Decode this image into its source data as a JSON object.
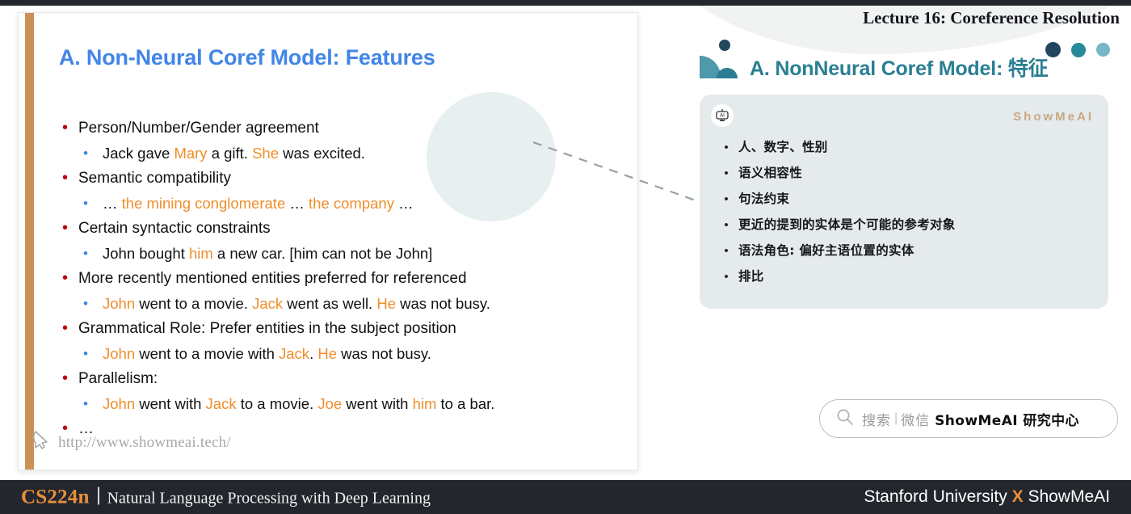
{
  "header": {
    "lecture_title": "Lecture 16: Coreference Resolution"
  },
  "slide": {
    "title": "A. Non-Neural Coref Model: Features",
    "watermark_url": "http://www.showmeai.tech/",
    "bullets": [
      {
        "level": 1,
        "bullet_char": "•",
        "segments": [
          {
            "text": "Person/Number/Gender agreement",
            "highlight": false
          }
        ]
      },
      {
        "level": 2,
        "bullet_char": "•",
        "segments": [
          {
            "text": "Jack gave ",
            "highlight": false
          },
          {
            "text": "Mary",
            "highlight": true
          },
          {
            "text": " a gift.  ",
            "highlight": false
          },
          {
            "text": "She",
            "highlight": true
          },
          {
            "text": " was excited.",
            "highlight": false
          }
        ]
      },
      {
        "level": 1,
        "bullet_char": "•",
        "segments": [
          {
            "text": "Semantic compatibility",
            "highlight": false
          }
        ]
      },
      {
        "level": 2,
        "bullet_char": "•",
        "segments": [
          {
            "text": "… ",
            "highlight": false
          },
          {
            "text": "the mining conglomerate",
            "highlight": true
          },
          {
            "text": " … ",
            "highlight": false
          },
          {
            "text": "the company",
            "highlight": true
          },
          {
            "text": " …",
            "highlight": false
          }
        ]
      },
      {
        "level": 1,
        "bullet_char": "•",
        "segments": [
          {
            "text": "Certain syntactic constraints",
            "highlight": false
          }
        ]
      },
      {
        "level": 2,
        "bullet_char": "•",
        "segments": [
          {
            "text": "John bought ",
            "highlight": false
          },
          {
            "text": "him",
            "highlight": true
          },
          {
            "text": " a new car. [him can not be John]",
            "highlight": false
          }
        ]
      },
      {
        "level": 1,
        "bullet_char": "•",
        "segments": [
          {
            "text": "More recently mentioned entities preferred for referenced",
            "highlight": false
          }
        ]
      },
      {
        "level": 2,
        "bullet_char": "•",
        "segments": [
          {
            "text": "John",
            "highlight": true
          },
          {
            "text": " went to a movie. ",
            "highlight": false
          },
          {
            "text": "Jack",
            "highlight": true
          },
          {
            "text": " went as well. ",
            "highlight": false
          },
          {
            "text": "He",
            "highlight": true
          },
          {
            "text": " was not busy.",
            "highlight": false
          }
        ]
      },
      {
        "level": 1,
        "bullet_char": "•",
        "segments": [
          {
            "text": "Grammatical Role: Prefer entities in the subject position",
            "highlight": false
          }
        ]
      },
      {
        "level": 2,
        "bullet_char": "•",
        "segments": [
          {
            "text": "John",
            "highlight": true
          },
          {
            "text": " went to a movie with ",
            "highlight": false
          },
          {
            "text": "Jack",
            "highlight": true
          },
          {
            "text": ". ",
            "highlight": false
          },
          {
            "text": "He",
            "highlight": true
          },
          {
            "text": " was not busy.",
            "highlight": false
          }
        ]
      },
      {
        "level": 1,
        "bullet_char": "•",
        "segments": [
          {
            "text": "Parallelism:",
            "highlight": false
          }
        ]
      },
      {
        "level": 2,
        "bullet_char": "•",
        "segments": [
          {
            "text": "John",
            "highlight": true
          },
          {
            "text": " went with ",
            "highlight": false
          },
          {
            "text": "Jack",
            "highlight": true
          },
          {
            "text": " to a movie. ",
            "highlight": false
          },
          {
            "text": "Joe",
            "highlight": true
          },
          {
            "text": " went with ",
            "highlight": false
          },
          {
            "text": "him",
            "highlight": true
          },
          {
            "text": " to a bar.",
            "highlight": false
          }
        ]
      },
      {
        "level": 1,
        "bullet_char": "•",
        "segments": [
          {
            "text": "…",
            "highlight": false
          }
        ]
      }
    ]
  },
  "right_panel": {
    "heading": "A. NonNeural Coref Model: 特征",
    "card_brand": "ShowMeAI",
    "items": [
      {
        "bullet_char": "•",
        "text": "人、数字、性别"
      },
      {
        "bullet_char": "•",
        "text": "语义相容性"
      },
      {
        "bullet_char": "•",
        "text": "句法约束"
      },
      {
        "bullet_char": "•",
        "text": "更近的提到的实体是个可能的参考对象"
      },
      {
        "bullet_char": "•",
        "text": "语法角色: 偏好主语位置的实体"
      },
      {
        "bullet_char": "•",
        "text": "排比"
      }
    ]
  },
  "search": {
    "placeholder": "搜索",
    "separator": "|",
    "channel": "微信",
    "brand": "ShowMeAI 研究中心"
  },
  "footer": {
    "course_code": "CS224n",
    "course_name": "Natural Language Processing with Deep Learning",
    "right_pre": "Stanford University ",
    "right_x": "X",
    "right_post": " ShowMeAI"
  },
  "colors": {
    "accent_orange": "#e8913a",
    "title_blue": "#4285e8",
    "highlight_orange": "#ef8e2b",
    "bullet_red": "#c00000",
    "bullet_blue": "#3b82e8",
    "teal": "#2a7f93",
    "footer_bg": "#24262e",
    "card_bg": "#e5eaec",
    "slide_accent_bar": "#cc9255"
  }
}
